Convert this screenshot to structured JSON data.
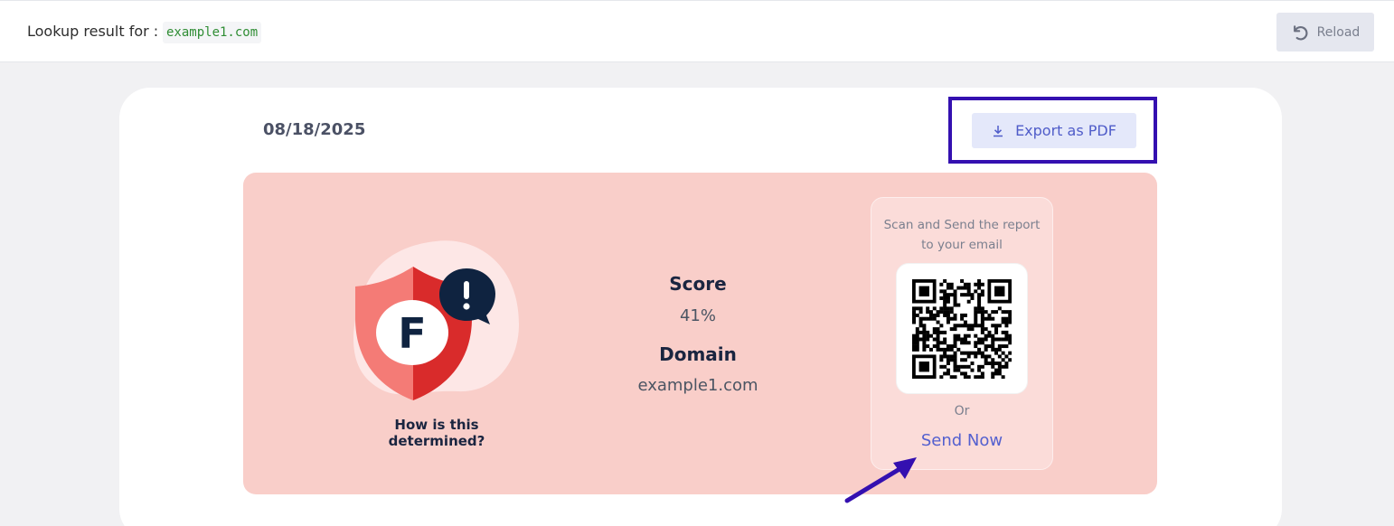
{
  "header": {
    "lookup_label": "Lookup result for :",
    "lookup_domain": "example1.com",
    "reload_label": "Reload",
    "reload_icon": "reload-icon"
  },
  "report": {
    "date": "08/18/2025",
    "export_label": "Export as PDF",
    "export_icon": "download-icon",
    "grade": "F",
    "grade_icon": "warning-shield-icon",
    "how_link": "How is this determined?",
    "score_label": "Score",
    "score_value": "41%",
    "domain_label": "Domain",
    "domain_value": "example1.com"
  },
  "email_panel": {
    "caption": "Scan and Send the report to your email",
    "qr_icon": "qr-code",
    "or_label": "Or",
    "send_label": "Send Now"
  },
  "colors": {
    "report_bg": "#f9cec9",
    "accent": "#5460cf",
    "highlight": "#3410b0",
    "shield_red": "#d92b2b",
    "badge_navy": "#0f2340"
  }
}
